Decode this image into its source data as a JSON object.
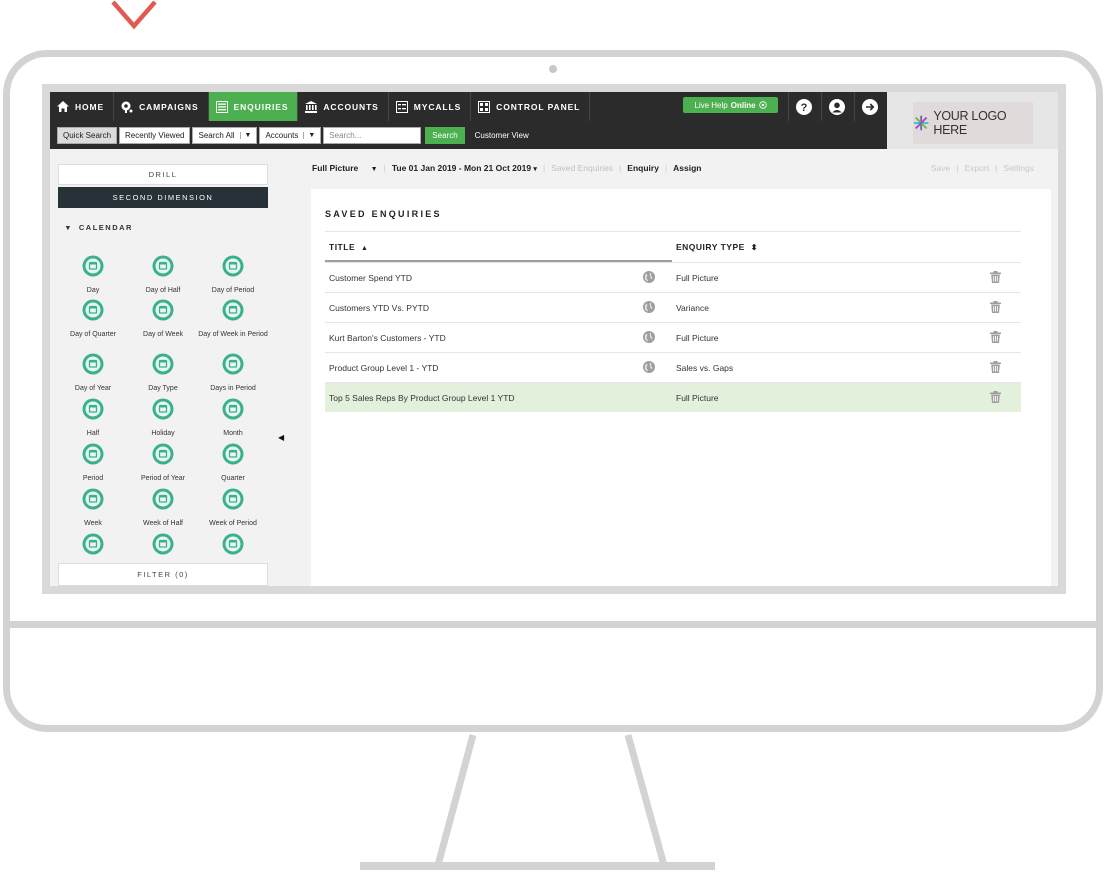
{
  "nav": {
    "items": [
      {
        "label": "HOME",
        "icon": "home-icon"
      },
      {
        "label": "CAMPAIGNS",
        "icon": "campaigns-icon"
      },
      {
        "label": "ENQUIRIES",
        "icon": "enquiries-icon",
        "active": true
      },
      {
        "label": "ACCOUNTS",
        "icon": "bank-icon"
      },
      {
        "label": "MYCALLS",
        "icon": "calls-icon"
      },
      {
        "label": "CONTROL PANEL",
        "icon": "grid-icon"
      }
    ],
    "live_help": {
      "label": "Live Help",
      "status": "Online"
    },
    "logo_text": "YOUR LOGO HERE"
  },
  "search": {
    "quick": "Quick Search",
    "recent": "Recently Viewed",
    "scope": "Search All",
    "type": "Accounts",
    "placeholder": "Search...",
    "button": "Search",
    "customer_view": "Customer View"
  },
  "sidebar": {
    "drill": "DRILL",
    "second": "SECOND DIMENSION",
    "calendar": "CALENDAR",
    "filter": "FILTER (0)",
    "items": [
      "Day",
      "Day of Half",
      "Day of Period",
      "Day of Quarter",
      "Day of Week",
      "Day of Week in Period",
      "Day of Year",
      "Day Type",
      "Days in Period",
      "Half",
      "Holiday",
      "Month",
      "Period",
      "Period of Year",
      "Quarter",
      "Week",
      "Week of Half",
      "Week of Period",
      "",
      "",
      ""
    ]
  },
  "toolbar": {
    "picture": "Full Picture",
    "dates": "Tue 01 Jan 2019 - Mon 21 Oct 2019",
    "saved": "Saved Enquiries",
    "enquiry": "Enquiry",
    "assign": "Assign",
    "save": "Save",
    "export": "Export",
    "settings": "Settings"
  },
  "panel": {
    "title": "SAVED ENQUIRIES",
    "col_title": "TITLE",
    "col_type": "ENQUIRY TYPE",
    "rows": [
      {
        "title": "Customer Spend YTD",
        "type": "Full Picture",
        "shared": true
      },
      {
        "title": "Customers YTD Vs. PYTD",
        "type": "Variance",
        "shared": true
      },
      {
        "title": "Kurt Barton's Customers - YTD",
        "type": "Full Picture",
        "shared": true
      },
      {
        "title": "Product Group Level 1 - YTD",
        "type": "Sales vs. Gaps",
        "shared": true
      },
      {
        "title": "Top 5 Sales Reps By Product Group Level 1 YTD",
        "type": "Full Picture",
        "shared": false,
        "selected": true
      }
    ]
  },
  "colors": {
    "accent": "#4caf50",
    "topbar": "#2b2b2b",
    "teal": "#3bb08f",
    "selected_row": "#e3f0dc",
    "chevron": "#e05a52"
  }
}
